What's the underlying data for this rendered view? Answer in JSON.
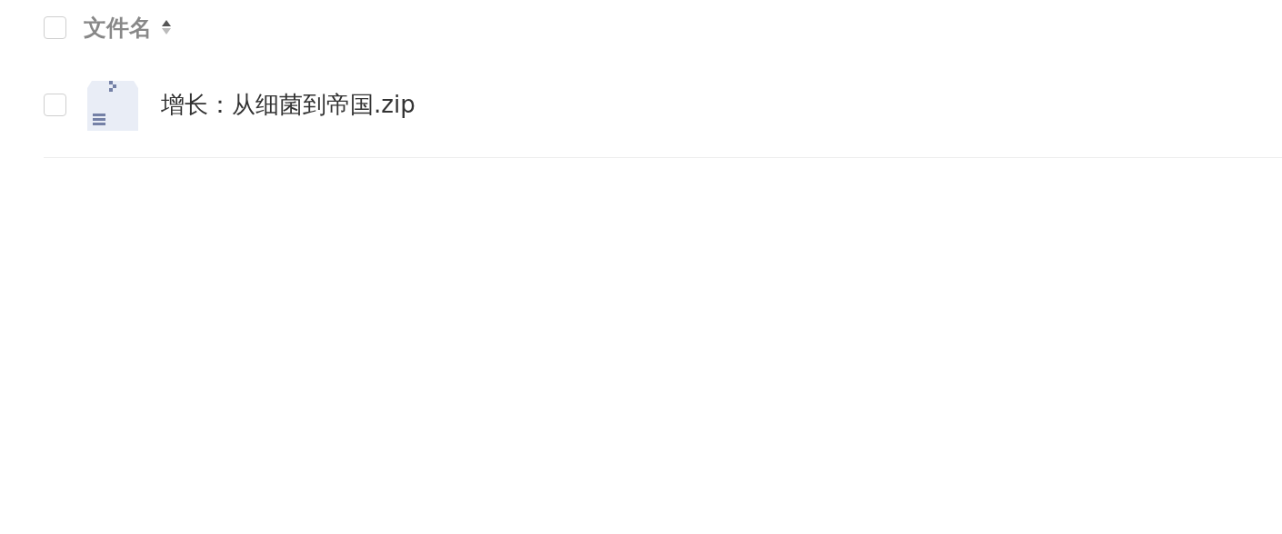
{
  "header": {
    "checked": false,
    "label": "文件名"
  },
  "rows": [
    {
      "checked": false,
      "name": "增长：从细菌到帝国.zip",
      "kind": "zip"
    }
  ]
}
